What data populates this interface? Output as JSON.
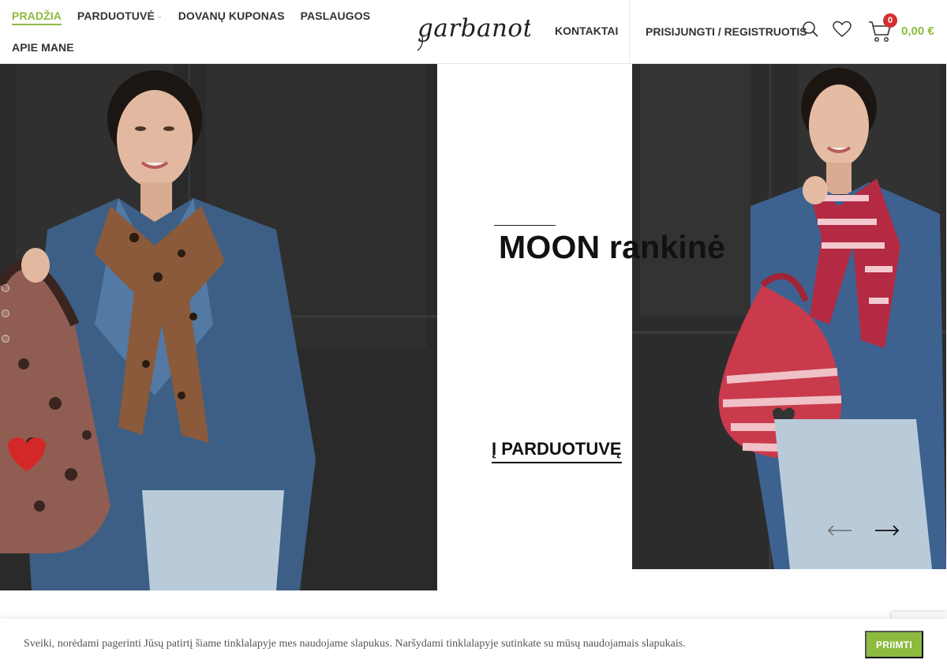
{
  "nav": {
    "items": [
      {
        "label": "PRADŽIA",
        "active": true
      },
      {
        "label": "PARDUOTUVĖ",
        "has_dropdown": true
      },
      {
        "label": "DOVANŲ KUPONAS"
      },
      {
        "label": "PASLAUGOS"
      }
    ],
    "second_row": [
      {
        "label": "APIE MANE"
      }
    ]
  },
  "logo": {
    "text": "garbanota"
  },
  "header_right": {
    "contacts_label": "KONTAKTAI",
    "login_label": "PRISIJUNGTI / REGISTRUOTIS",
    "search_icon": "search-icon",
    "wishlist_icon": "heart-icon",
    "cart_icon": "cart-icon",
    "cart_count": "0",
    "cart_total": "0,00 €"
  },
  "hero": {
    "title": "MOON rankinė",
    "button_label": "Į PARDUOTUVĘ"
  },
  "cookie": {
    "text": "Sveiki, norėdami pagerinti Jūsų patirtį šiame tinklalapyje mes naudojame slapukus. Naršydami tinklalapyje sutinkate su mūsų naudojamais slapukais.",
    "accept_label": "PRIIMTI"
  },
  "colors": {
    "accent": "#8dbb3f",
    "badge": "#d32f2f"
  }
}
